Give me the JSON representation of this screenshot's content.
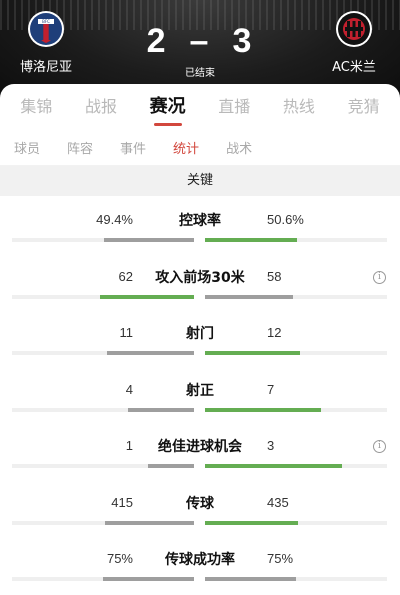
{
  "match": {
    "home_team": "博洛尼亚",
    "away_team": "AC米兰",
    "home_score": "2",
    "away_score": "3",
    "separator": "–",
    "status": "已结束"
  },
  "main_tabs": [
    "集锦",
    "战报",
    "赛况",
    "直播",
    "热线",
    "竞猜"
  ],
  "main_tab_active": 2,
  "sub_tabs": [
    "球员",
    "阵容",
    "事件",
    "统计",
    "战术"
  ],
  "sub_tab_active": 3,
  "section": {
    "title": "关键"
  },
  "stats": [
    {
      "label": "控球率",
      "home": "49.4%",
      "away": "50.6%",
      "home_frac": 0.494,
      "away_frac": 0.506,
      "info": false,
      "leader": "away"
    },
    {
      "label": "攻入前场30米",
      "home": "62",
      "away": "58",
      "home_frac": 0.517,
      "away_frac": 0.483,
      "info": true,
      "leader": "home"
    },
    {
      "label": "射门",
      "home": "11",
      "away": "12",
      "home_frac": 0.478,
      "away_frac": 0.522,
      "info": false,
      "leader": "away"
    },
    {
      "label": "射正",
      "home": "4",
      "away": "7",
      "home_frac": 0.364,
      "away_frac": 0.636,
      "info": false,
      "leader": "away"
    },
    {
      "label": "绝佳进球机会",
      "home": "1",
      "away": "3",
      "home_frac": 0.25,
      "away_frac": 0.75,
      "info": true,
      "leader": "away"
    },
    {
      "label": "传球",
      "home": "415",
      "away": "435",
      "home_frac": 0.488,
      "away_frac": 0.512,
      "info": false,
      "leader": "away"
    },
    {
      "label": "传球成功率",
      "home": "75%",
      "away": "75%",
      "home_frac": 0.5,
      "away_frac": 0.5,
      "info": false,
      "leader": "none"
    }
  ],
  "icons": {
    "info": "info-icon",
    "home_crest": "bologna-crest-icon",
    "away_crest": "ac-milan-crest-icon"
  },
  "colors": {
    "accent": "#d2473d",
    "leader_bar": "#64ad52",
    "other_bar": "#9e9e9e"
  }
}
